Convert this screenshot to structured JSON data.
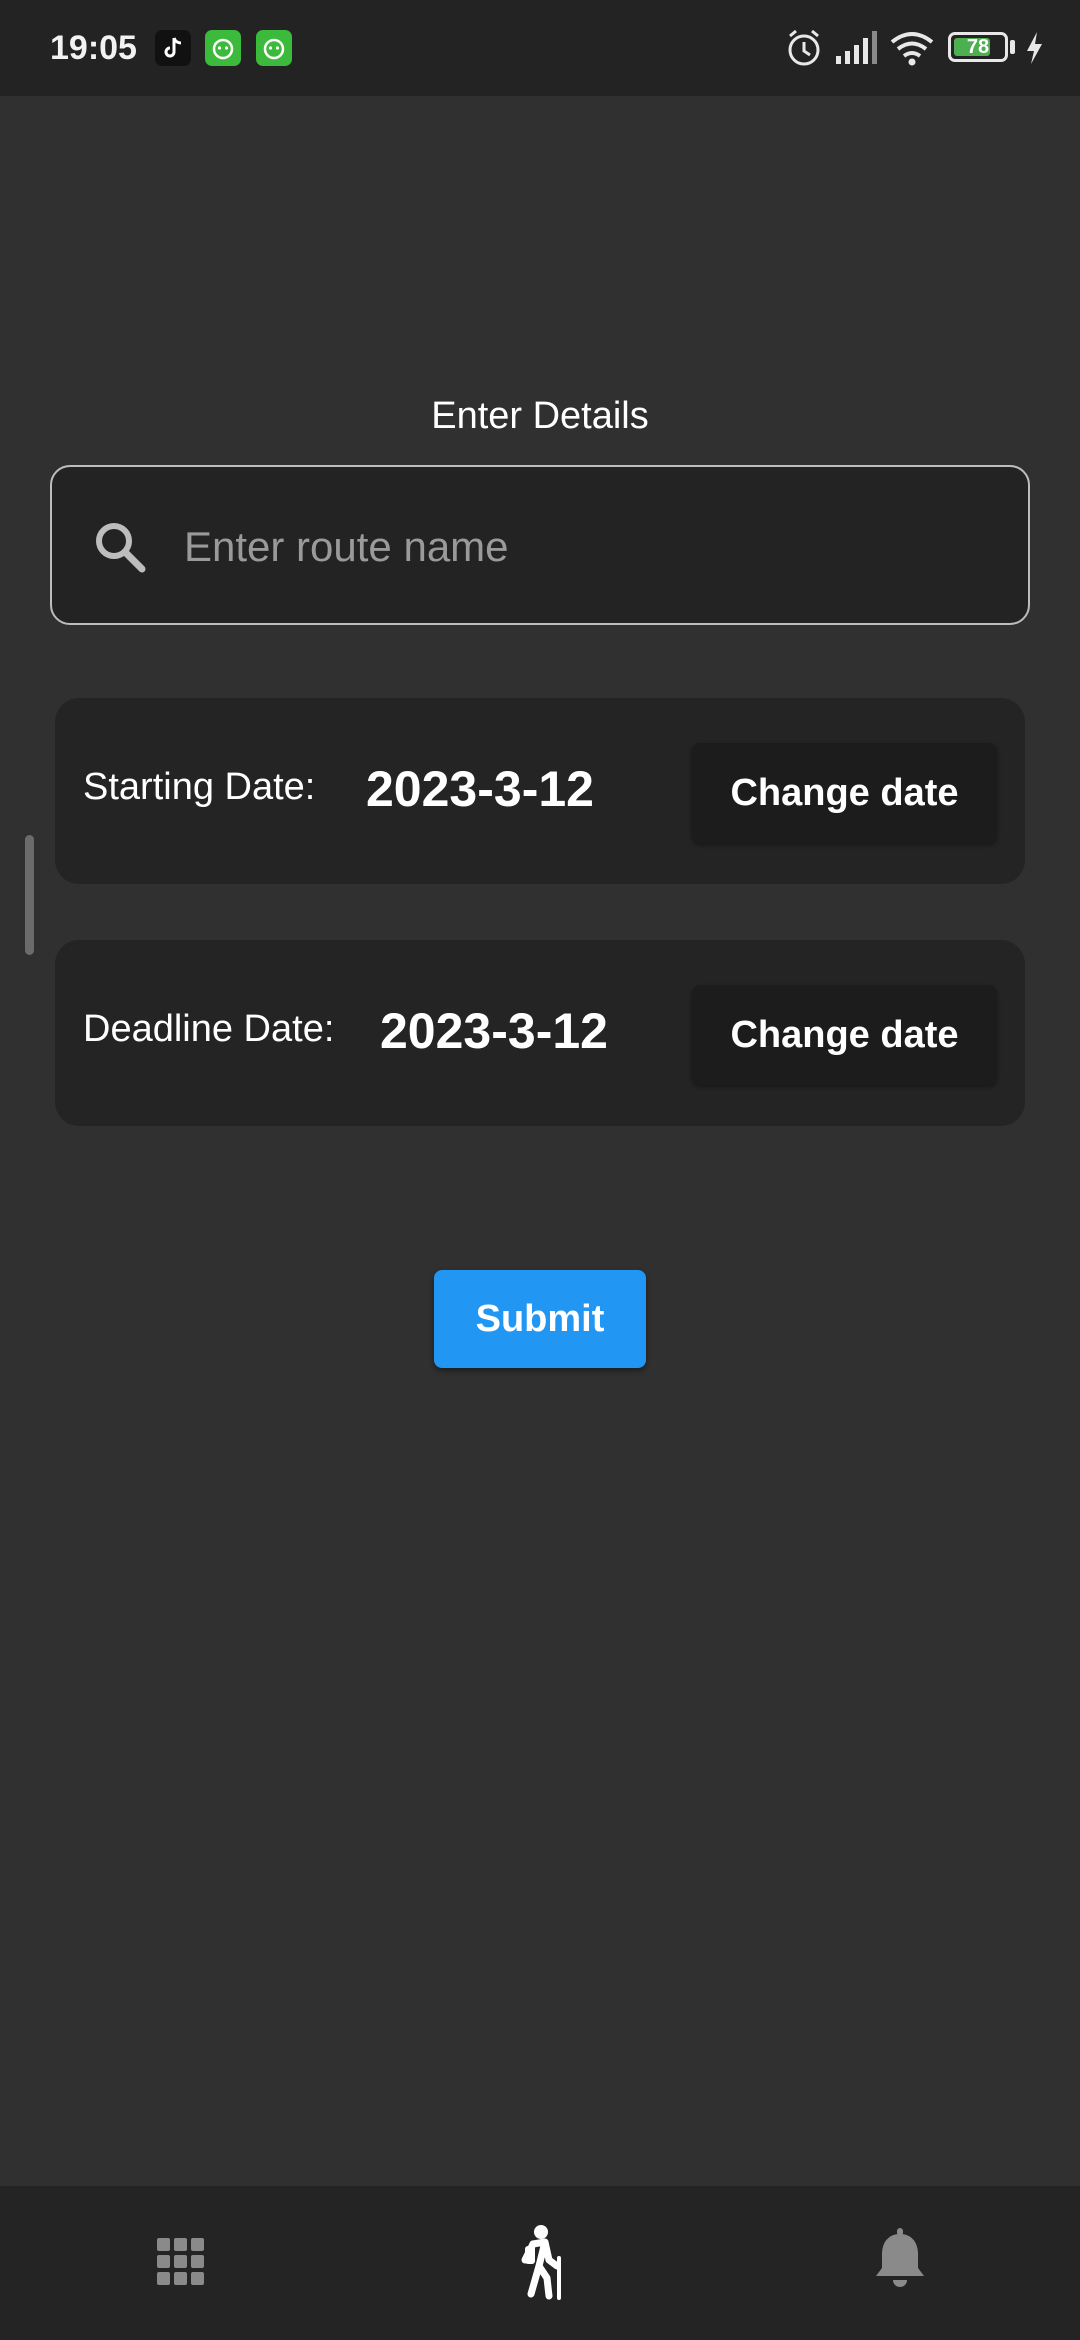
{
  "status_bar": {
    "time": "19:05",
    "battery_level": "78",
    "notification_icons": [
      "tiktok-icon",
      "app-icon",
      "app-icon"
    ],
    "system_icons": [
      "alarm-icon",
      "signal-icon",
      "wifi-icon",
      "battery-icon",
      "charging-icon"
    ]
  },
  "form": {
    "title": "Enter Details",
    "route_name_placeholder": "Enter route name",
    "route_name_value": ""
  },
  "starting_date": {
    "label": "Starting Date:",
    "value": "2023-3-12",
    "button_label": "Change date"
  },
  "deadline_date": {
    "label": "Deadline Date:",
    "value": "2023-3-12",
    "button_label": "Change date"
  },
  "submit_label": "Submit",
  "bottom_nav": {
    "items": [
      {
        "icon": "apps-grid-icon",
        "active": false
      },
      {
        "icon": "hiking-icon",
        "active": true
      },
      {
        "icon": "bell-icon",
        "active": false
      }
    ]
  },
  "colors": {
    "background": "#303030",
    "surface": "#242424",
    "accent": "#2196f3"
  }
}
